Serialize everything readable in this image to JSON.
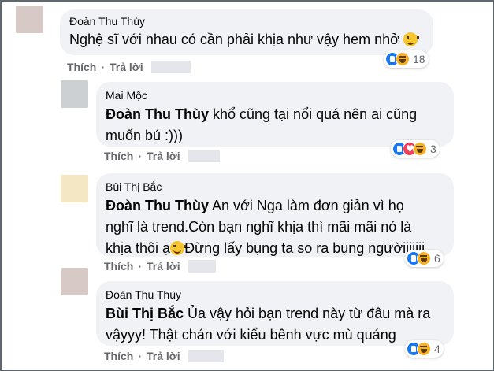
{
  "comments": [
    {
      "author": "Đoàn Thu Thùy",
      "mention": "",
      "text": "Nghệ sĩ với nhau có cần phải khịa như vậy hem nhở",
      "emoji": "smile-emoji",
      "like_label": "Thích",
      "reply_label": "Trả lời",
      "reactions": [
        "like",
        "haha"
      ],
      "reaction_count": "18",
      "avatar_color": "#d7c9c6"
    },
    {
      "author": "Mai Mộc",
      "mention": "Đoàn Thu Thùy",
      "text_line1": " khổ cũng tại nổi quá nên ai cũng",
      "text_line2": "muốn bú :)))",
      "like_label": "Thích",
      "reply_label": "Trả lời",
      "reactions": [
        "like",
        "love",
        "haha"
      ],
      "reaction_count": "3",
      "avatar_color": "#ccd0d3"
    },
    {
      "author": "Bùi Thị Bắc",
      "mention": "Đoàn Thu Thùy",
      "text_line1": " An với Nga làm đơn giản vì họ",
      "text_line2": "nghĩ là trend.Còn bạn nghĩ khịa thì mãi mãi nó là",
      "text_line3a": "khịa thôi ạ",
      "text_line3b": "Đừng lấy bụng ta so ra bụng ngườiiiiiii",
      "like_label": "Thích",
      "reply_label": "Trả lời",
      "reactions": [
        "like",
        "haha"
      ],
      "reaction_count": "6",
      "avatar_color": "#f3e7c4"
    },
    {
      "author": "Đoàn Thu Thùy",
      "mention": "Bùi Thị Bắc",
      "text_line1": " Ủa vậy hỏi bạn trend này từ đâu mà ra",
      "text_line2": "vậyyy! Thật chán với kiểu bênh vực mù quáng",
      "like_label": "Thích",
      "reply_label": "Trả lời",
      "reactions": [
        "like",
        "haha"
      ],
      "reaction_count": "4",
      "avatar_color": "#d7c9c6"
    }
  ],
  "colors": {
    "bubble": "#f0f2f5",
    "action_text": "#65676b",
    "like_blue": "#1877f2",
    "love_red": "#f33e58",
    "haha_yellow": "#f7b125"
  }
}
